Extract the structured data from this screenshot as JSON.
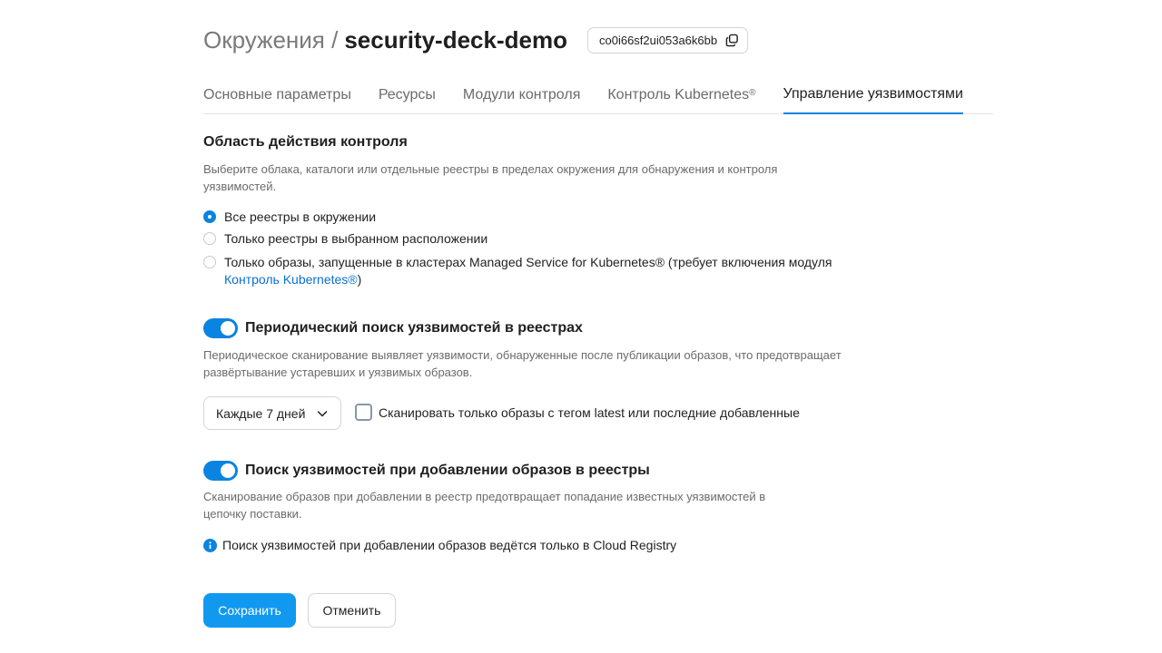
{
  "header": {
    "breadcrumb": "Окружения /",
    "title": "security-deck-demo",
    "id": "co0i66sf2ui053a6k6bb"
  },
  "tabs": [
    {
      "label": "Основные параметры"
    },
    {
      "label": "Ресурсы"
    },
    {
      "label": "Модули контроля"
    },
    {
      "label": "Контроль Kubernetes",
      "sup": "®"
    },
    {
      "label": "Управление уязвимостями",
      "active": true
    }
  ],
  "scope": {
    "title": "Область действия контроля",
    "description": "Выберите облака, каталоги или отдельные реестры в пределах окружения для обнаружения и контроля уязвимостей.",
    "options": [
      {
        "label": "Все реестры в окружении",
        "checked": true
      },
      {
        "label": "Только реестры в выбранном расположении",
        "checked": false
      },
      {
        "label": "Только образы, запущенные в кластерах Managed Service for Kubernetes® (требует включения модуля ",
        "link": "Контроль Kubernetes®",
        "suffix": ")",
        "checked": false
      }
    ]
  },
  "periodic": {
    "enabled": true,
    "title": "Периодический поиск уязвимостей в реестрах",
    "description": "Периодическое сканирование выявляет уязвимости, обнаруженные после публикации образов, что предотвращает развёртывание устаревших и уязвимых образов.",
    "frequency": "Каждые 7 дней",
    "latest_only_label": "Сканировать только образы с тегом latest или последние добавленные",
    "latest_only_checked": false
  },
  "on_push": {
    "enabled": true,
    "title": "Поиск уязвимостей при добавлении образов в реестры",
    "description": "Сканирование образов при добавлении в реестр предотвращает попадание известных уязвимостей в цепочку поставки.",
    "info": "Поиск уязвимостей при добавлении образов ведётся только в Cloud Registry"
  },
  "actions": {
    "save": "Сохранить",
    "cancel": "Отменить"
  },
  "colors": {
    "accent": "#0a84e0",
    "primary_button": "#1199f0",
    "link": "#0a6fd1"
  },
  "icons": {
    "copy": "copy-icon",
    "chevron": "chevron-down-icon",
    "info": "info-icon"
  }
}
